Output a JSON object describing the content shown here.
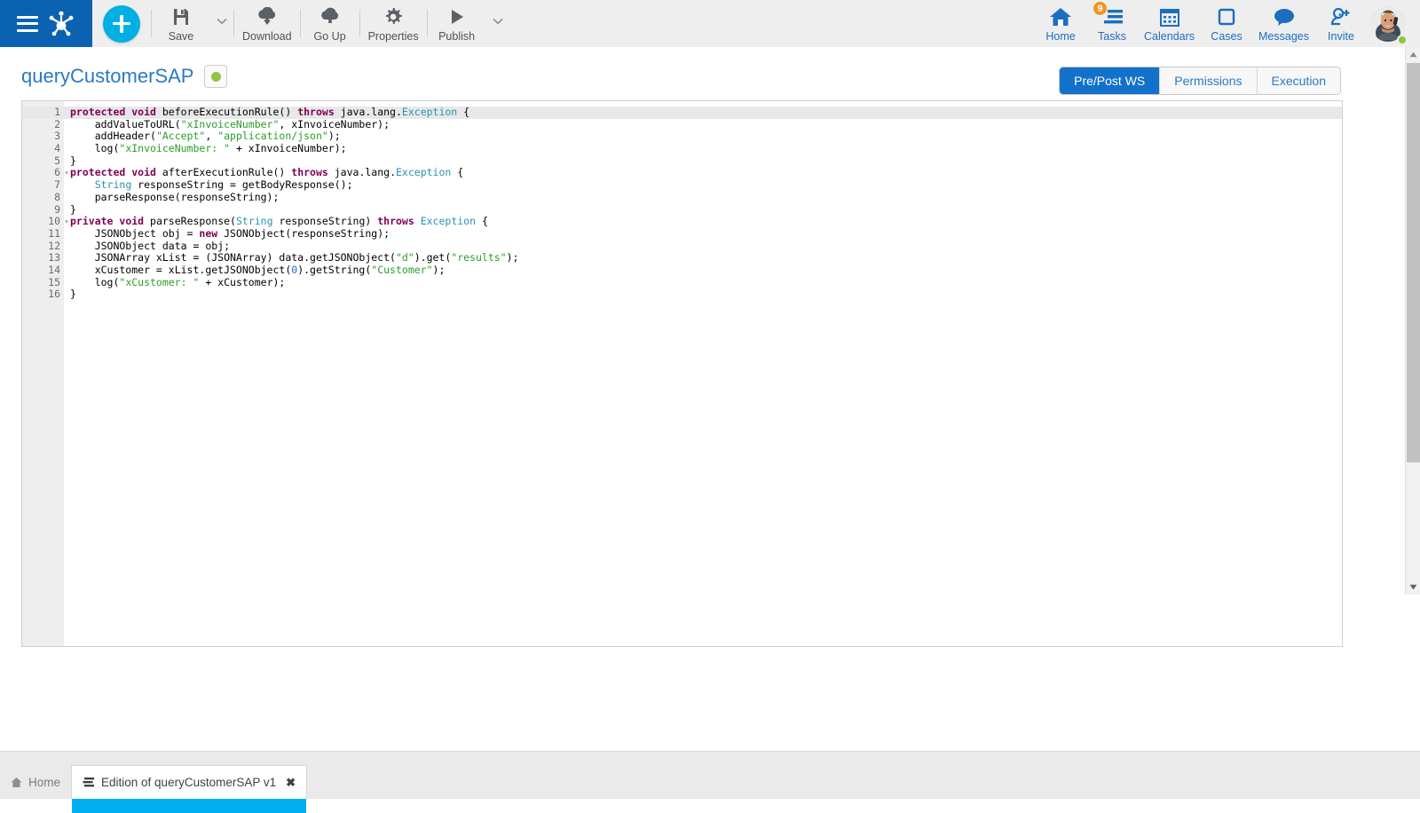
{
  "toolbar": {
    "menu_icon": "hamburger-icon",
    "logo_icon": "bonita-frog-logo",
    "add_button_icon": "plus-icon",
    "items": [
      {
        "label": "Save",
        "icon": "floppy-disk-icon",
        "has_dropdown": true
      },
      {
        "label": "Download",
        "icon": "download-cloud-icon",
        "has_dropdown": false
      },
      {
        "label": "Go Up",
        "icon": "upload-cloud-icon",
        "has_dropdown": false
      },
      {
        "label": "Properties",
        "icon": "gear-icon",
        "has_dropdown": false
      },
      {
        "label": "Publish",
        "icon": "play-triangle-icon",
        "has_dropdown": true
      }
    ],
    "nav": [
      {
        "label": "Home",
        "icon": "house-icon",
        "badge": ""
      },
      {
        "label": "Tasks",
        "icon": "tasks-list-icon",
        "badge": "9"
      },
      {
        "label": "Calendars",
        "icon": "calendar-icon",
        "badge": ""
      },
      {
        "label": "Cases",
        "icon": "square-case-icon",
        "badge": ""
      },
      {
        "label": "Messages",
        "icon": "speech-bubble-icon",
        "badge": ""
      },
      {
        "label": "Invite",
        "icon": "person-plus-icon",
        "badge": ""
      }
    ],
    "avatar": {
      "icon": "user-avatar-photo",
      "status": "online"
    }
  },
  "header": {
    "title": "queryCustomerSAP",
    "status_icon": "green-status-dot",
    "tabs": [
      {
        "label": "Pre/Post WS",
        "active": true
      },
      {
        "label": "Permissions",
        "active": false
      },
      {
        "label": "Execution",
        "active": false
      }
    ]
  },
  "editor": {
    "active_line": 1,
    "lines": [
      {
        "n": "1",
        "fold": true,
        "tokens": [
          {
            "t": "protected",
            "c": "kw"
          },
          {
            "t": " ",
            "c": ""
          },
          {
            "t": "void",
            "c": "kw"
          },
          {
            "t": " beforeExecutionRule() ",
            "c": ""
          },
          {
            "t": "throws",
            "c": "kw"
          },
          {
            "t": " java.lang.",
            "c": ""
          },
          {
            "t": "Exception",
            "c": "typ"
          },
          {
            "t": " {",
            "c": ""
          }
        ]
      },
      {
        "n": "2",
        "fold": false,
        "tokens": [
          {
            "t": "    addValueToURL(",
            "c": ""
          },
          {
            "t": "\"xInvoiceNumber\"",
            "c": "str"
          },
          {
            "t": ", xInvoiceNumber);",
            "c": ""
          }
        ]
      },
      {
        "n": "3",
        "fold": false,
        "tokens": [
          {
            "t": "    addHeader(",
            "c": ""
          },
          {
            "t": "\"Accept\"",
            "c": "str"
          },
          {
            "t": ", ",
            "c": ""
          },
          {
            "t": "\"application/json\"",
            "c": "str"
          },
          {
            "t": ");",
            "c": ""
          }
        ]
      },
      {
        "n": "4",
        "fold": false,
        "tokens": [
          {
            "t": "    log(",
            "c": ""
          },
          {
            "t": "\"xInvoiceNumber: \"",
            "c": "str"
          },
          {
            "t": " + xInvoiceNumber);",
            "c": ""
          }
        ]
      },
      {
        "n": "5",
        "fold": false,
        "tokens": [
          {
            "t": "}",
            "c": ""
          }
        ]
      },
      {
        "n": "6",
        "fold": true,
        "tokens": [
          {
            "t": "protected",
            "c": "kw"
          },
          {
            "t": " ",
            "c": ""
          },
          {
            "t": "void",
            "c": "kw"
          },
          {
            "t": " afterExecutionRule() ",
            "c": ""
          },
          {
            "t": "throws",
            "c": "kw"
          },
          {
            "t": " java.lang.",
            "c": ""
          },
          {
            "t": "Exception",
            "c": "typ"
          },
          {
            "t": " {",
            "c": ""
          }
        ]
      },
      {
        "n": "7",
        "fold": false,
        "tokens": [
          {
            "t": "    ",
            "c": ""
          },
          {
            "t": "String",
            "c": "typ"
          },
          {
            "t": " responseString = getBodyResponse();",
            "c": ""
          }
        ]
      },
      {
        "n": "8",
        "fold": false,
        "tokens": [
          {
            "t": "    parseResponse(responseString);",
            "c": ""
          }
        ]
      },
      {
        "n": "9",
        "fold": false,
        "tokens": [
          {
            "t": "}",
            "c": ""
          }
        ]
      },
      {
        "n": "10",
        "fold": true,
        "tokens": [
          {
            "t": "private",
            "c": "kw"
          },
          {
            "t": " ",
            "c": ""
          },
          {
            "t": "void",
            "c": "kw"
          },
          {
            "t": " parseResponse(",
            "c": ""
          },
          {
            "t": "String",
            "c": "typ"
          },
          {
            "t": " responseString) ",
            "c": ""
          },
          {
            "t": "throws",
            "c": "kw"
          },
          {
            "t": " ",
            "c": ""
          },
          {
            "t": "Exception",
            "c": "typ"
          },
          {
            "t": " {",
            "c": ""
          }
        ]
      },
      {
        "n": "11",
        "fold": false,
        "tokens": [
          {
            "t": "    JSONObject obj = ",
            "c": ""
          },
          {
            "t": "new",
            "c": "kw"
          },
          {
            "t": " JSONObject(responseString);",
            "c": ""
          }
        ]
      },
      {
        "n": "12",
        "fold": false,
        "tokens": [
          {
            "t": "    JSONObject data = obj;",
            "c": ""
          }
        ]
      },
      {
        "n": "13",
        "fold": false,
        "tokens": [
          {
            "t": "    JSONArray xList = (JSONArray) data.getJSONObject(",
            "c": ""
          },
          {
            "t": "\"d\"",
            "c": "str"
          },
          {
            "t": ").get(",
            "c": ""
          },
          {
            "t": "\"results\"",
            "c": "str"
          },
          {
            "t": ");",
            "c": ""
          }
        ]
      },
      {
        "n": "14",
        "fold": false,
        "tokens": [
          {
            "t": "    xCustomer = xList.getJSONObject(",
            "c": ""
          },
          {
            "t": "0",
            "c": "num2"
          },
          {
            "t": ").getString(",
            "c": ""
          },
          {
            "t": "\"Customer\"",
            "c": "str"
          },
          {
            "t": ");",
            "c": ""
          }
        ]
      },
      {
        "n": "15",
        "fold": false,
        "tokens": [
          {
            "t": "    log(",
            "c": ""
          },
          {
            "t": "\"xCustomer: \"",
            "c": "str"
          },
          {
            "t": " + xCustomer);",
            "c": ""
          }
        ]
      },
      {
        "n": "16",
        "fold": false,
        "tokens": [
          {
            "t": "}",
            "c": ""
          }
        ]
      }
    ]
  },
  "taskbar": {
    "tabs": [
      {
        "label": "Home",
        "icon": "home-icon",
        "active": false,
        "closable": false
      },
      {
        "label": "Edition of queryCustomerSAP v1",
        "icon": "document-lines-icon",
        "active": true,
        "closable": true,
        "close_label": "✖"
      }
    ]
  },
  "colors": {
    "brand_blue": "#0a62b0",
    "accent_cyan": "#00afe4",
    "active_tab_blue": "#1271ca",
    "link_blue": "#2a7ac4",
    "status_green": "#8dc63f",
    "badge_orange": "#f0951e"
  }
}
